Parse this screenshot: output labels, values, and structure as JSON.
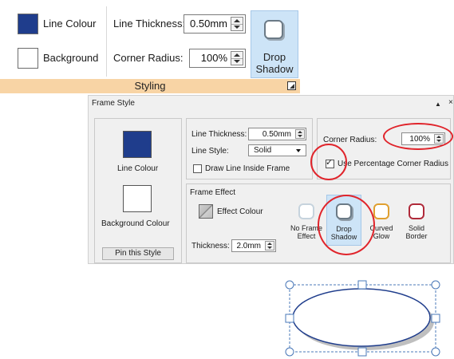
{
  "ribbon": {
    "line_colour_label": "Line Colour",
    "background_label": "Background",
    "line_thickness_label": "Line Thickness:",
    "line_thickness_value": "0.50mm",
    "corner_radius_label": "Corner Radius:",
    "corner_radius_value": "100%",
    "drop_shadow_line1": "Drop",
    "drop_shadow_line2": "Shadow",
    "group_label": "Styling",
    "line_colour": "#1f3d8c",
    "background_colour": "#ffffff"
  },
  "panel": {
    "title": "Frame Style",
    "collapse_glyph": "▲",
    "close_glyph": "×",
    "line_colour_label": "Line Colour",
    "background_colour_label": "Background Colour",
    "pin_button": "Pin this Style",
    "line_thickness_label": "Line Thickness:",
    "line_thickness_value": "0.50mm",
    "line_style_label": "Line Style:",
    "line_style_value": "Solid",
    "draw_inside_label": "Draw Line Inside Frame",
    "corner_radius_label": "Corner Radius:",
    "corner_radius_value": "100%",
    "use_percentage_label": "Use Percentage Corner Radius",
    "use_percentage_checked": true,
    "frame_effect_label": "Frame Effect",
    "effect_colour_label": "Effect Colour",
    "thickness_label": "Thickness:",
    "thickness_value": "2.0mm",
    "effects": {
      "no_frame_1": "No Frame",
      "no_frame_2": "Effect",
      "drop_1": "Drop",
      "drop_2": "Shadow",
      "curved_1": "Curved",
      "curved_2": "Glow",
      "solid_1": "Solid",
      "solid_2": "Border"
    },
    "highlight_colour": "#e0242b",
    "selected_effect": "Drop Shadow"
  }
}
